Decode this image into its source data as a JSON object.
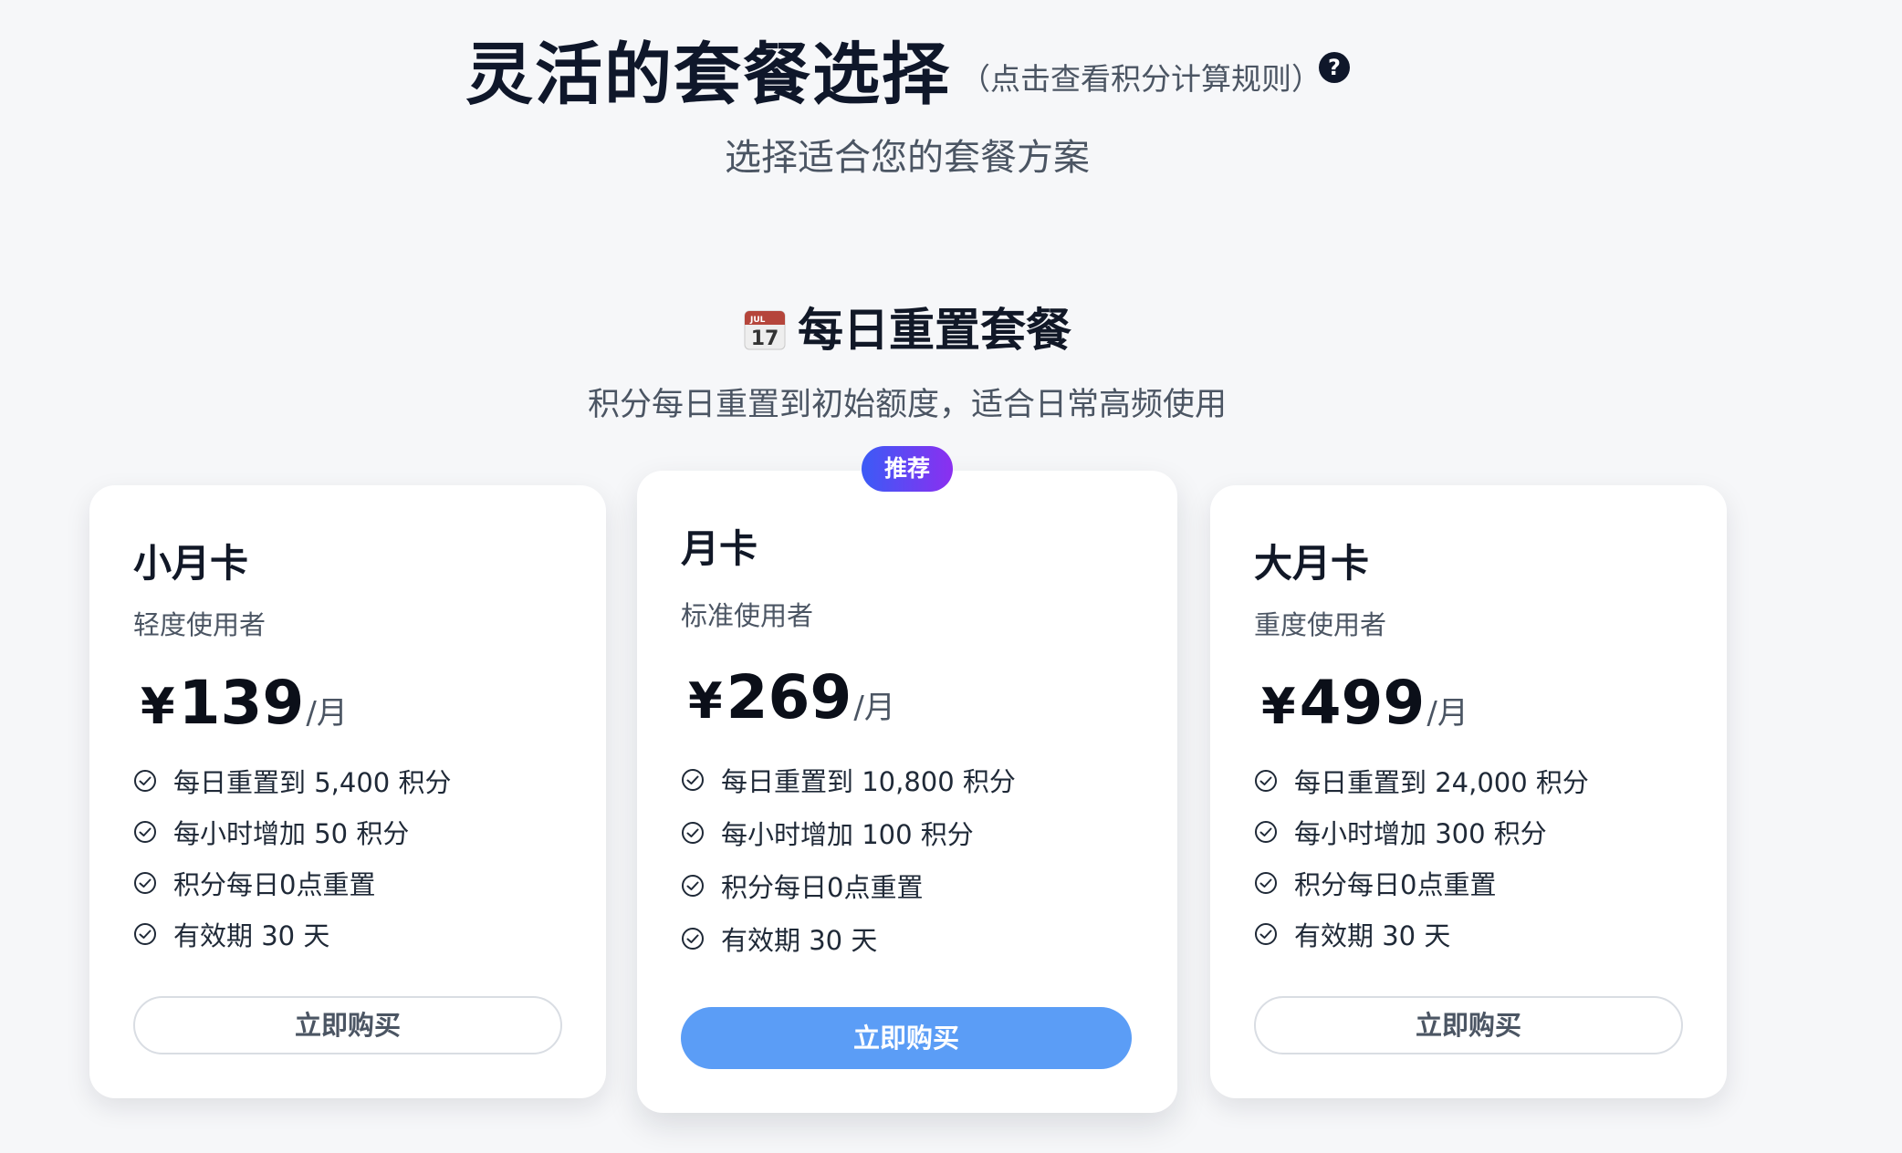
{
  "header": {
    "title": "灵活的套餐选择",
    "rules_link": "（点击查看积分计算规则）",
    "help_glyph": "?",
    "subtitle": "选择适合您的套餐方案"
  },
  "section": {
    "icon": "calendar-icon",
    "title": "每日重置套餐",
    "description": "积分每日重置到初始额度，适合日常高频使用"
  },
  "colors": {
    "primary_button": "#5b9df6",
    "badge_gradient_start": "#3b5bf6",
    "badge_gradient_end": "#8b2ff0"
  },
  "plans": [
    {
      "name": "小月卡",
      "audience": "轻度使用者",
      "currency": "¥",
      "price": "139",
      "unit": "/月",
      "features": [
        "每日重置到 5,400 积分",
        "每小时增加 50 积分",
        "积分每日0点重置",
        "有效期 30 天"
      ],
      "button_label": "立即购买"
    },
    {
      "name": "月卡",
      "audience": "标准使用者",
      "currency": "¥",
      "price": "269",
      "unit": "/月",
      "badge": "推荐",
      "features": [
        "每日重置到 10,800 积分",
        "每小时增加 100 积分",
        "积分每日0点重置",
        "有效期 30 天"
      ],
      "button_label": "立即购买"
    },
    {
      "name": "大月卡",
      "audience": "重度使用者",
      "currency": "¥",
      "price": "499",
      "unit": "/月",
      "features": [
        "每日重置到 24,000 积分",
        "每小时增加 300 积分",
        "积分每日0点重置",
        "有效期 30 天"
      ],
      "button_label": "立即购买"
    }
  ]
}
